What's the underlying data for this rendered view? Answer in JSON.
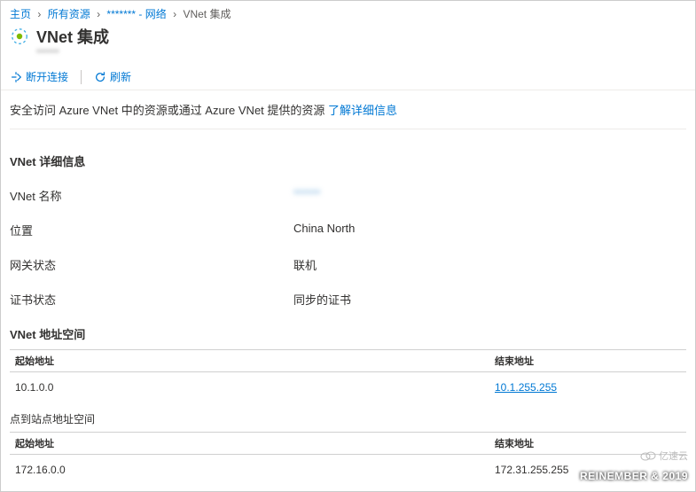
{
  "breadcrumb": {
    "home": "主页",
    "all_resources": "所有资源",
    "resource": "******* - 网络",
    "current": "VNet 集成"
  },
  "header": {
    "title": "VNet 集成",
    "subtitle": "******"
  },
  "toolbar": {
    "disconnect": "断开连接",
    "refresh": "刷新"
  },
  "intro": {
    "text": "安全访问 Azure VNet 中的资源或通过 Azure VNet 提供的资源 ",
    "link": "了解详细信息"
  },
  "details": {
    "section_title": "VNet 详细信息",
    "rows": {
      "name_label": "VNet 名称",
      "name_value": "******",
      "location_label": "位置",
      "location_value": "China North",
      "gateway_label": "网关状态",
      "gateway_value": "联机",
      "cert_label": "证书状态",
      "cert_value": "同步的证书"
    }
  },
  "address_space": {
    "section_title": "VNet 地址空间",
    "col_start": "起始地址",
    "col_end": "结束地址",
    "row": {
      "start": "10.1.0.0",
      "end": "10.1.255.255"
    }
  },
  "p2s": {
    "label": "点到站点地址空间",
    "col_start": "起始地址",
    "col_end": "结束地址",
    "row": {
      "start": "172.16.0.0",
      "end": "172.31.255.255"
    }
  },
  "watermark": {
    "logo": "亿速云",
    "text": "REINEMBER & 2019"
  }
}
